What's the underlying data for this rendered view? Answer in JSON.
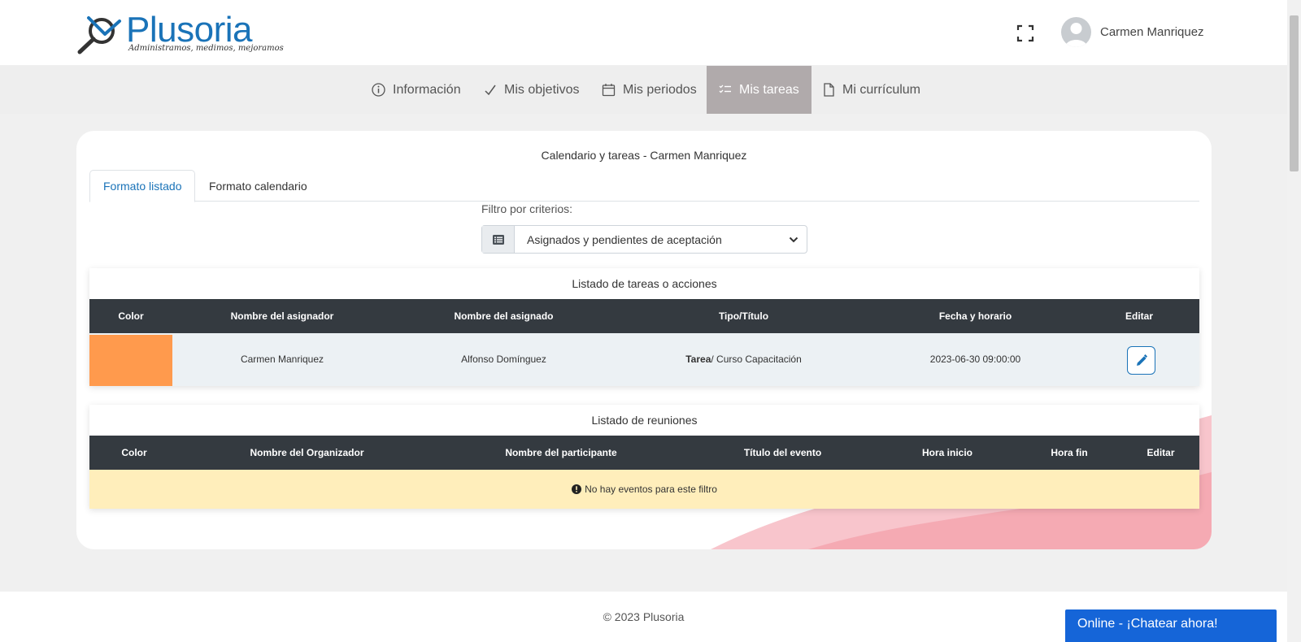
{
  "brand": {
    "name": "Plusoria",
    "tagline": "Administramos, medimos, mejoramos"
  },
  "user": {
    "name": "Carmen Manriquez"
  },
  "nav": {
    "items": [
      {
        "label": "Información",
        "icon": "info-circle-icon"
      },
      {
        "label": "Mis objetivos",
        "icon": "check-icon"
      },
      {
        "label": "Mis periodos",
        "icon": "calendar-icon"
      },
      {
        "label": "Mis tareas",
        "icon": "task-list-icon",
        "active": true
      },
      {
        "label": "Mi currículum",
        "icon": "document-icon"
      }
    ]
  },
  "page": {
    "title": "Calendario y tareas - Carmen Manriquez",
    "tabs": [
      {
        "label": "Formato listado",
        "active": true
      },
      {
        "label": "Formato calendario"
      }
    ],
    "filter": {
      "label": "Filtro por criterios:",
      "selected": "Asignados y pendientes de aceptación"
    }
  },
  "tasks": {
    "title": "Listado de tareas o acciones",
    "columns": [
      "Color",
      "Nombre del asignador",
      "Nombre del asignado",
      "Tipo/Título",
      "Fecha y horario",
      "Editar"
    ],
    "rows": [
      {
        "color": "#ff9a4d",
        "assigner": "Carmen Manriquez",
        "assignee": "Alfonso Domínguez",
        "type": "Tarea",
        "title": "/ Curso Capacitación",
        "datetime": "2023-06-30 09:00:00"
      }
    ]
  },
  "meetings": {
    "title": "Listado de reuniones",
    "columns": [
      "Color",
      "Nombre del Organizador",
      "Nombre del participante",
      "Título del evento",
      "Hora inicio",
      "Hora fin",
      "Editar"
    ],
    "empty_message": "No hay eventos para este filtro"
  },
  "footer": {
    "copyright": "© 2023 Plusoria"
  },
  "chat": {
    "label": "Online - ¡Chatear ahora!"
  },
  "colors": {
    "brand_blue": "#1a73b8",
    "nav_active": "#b0aaab",
    "table_header": "#343a40",
    "empty_row": "#ffeebb",
    "chat_button": "#1565d8"
  }
}
